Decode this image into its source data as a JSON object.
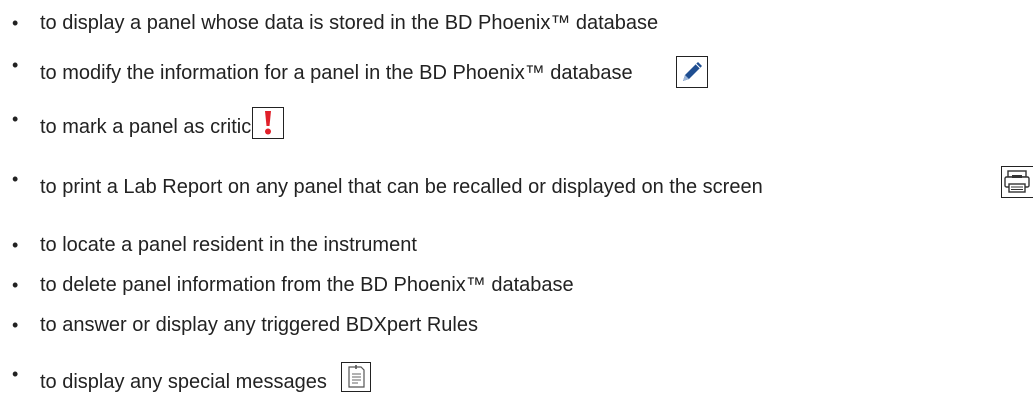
{
  "bullets": [
    {
      "text": "to display a panel whose data is stored in the BD Phoenix™ database",
      "icon": null
    },
    {
      "text": "to modify the information for a panel in the BD Phoenix™ database",
      "icon": "pencil-icon"
    },
    {
      "text": "to mark a panel as critical",
      "icon": "exclamation-icon"
    },
    {
      "text": "to print a Lab Report on any panel that can be recalled or displayed on the screen",
      "icon": "printer-icon"
    },
    {
      "text": "to locate a panel resident in the instrument",
      "icon": null
    },
    {
      "text": "to delete panel information from the BD Phoenix™ database",
      "icon": null
    },
    {
      "text": "to answer or display any triggered BDXpert Rules",
      "icon": null
    },
    {
      "text": "to display any special messages",
      "icon": "note-icon"
    }
  ],
  "bullet_glyph": "•",
  "colors": {
    "text": "#222222",
    "exclamation": "#e0202a",
    "pencil": "#1f4e91"
  }
}
